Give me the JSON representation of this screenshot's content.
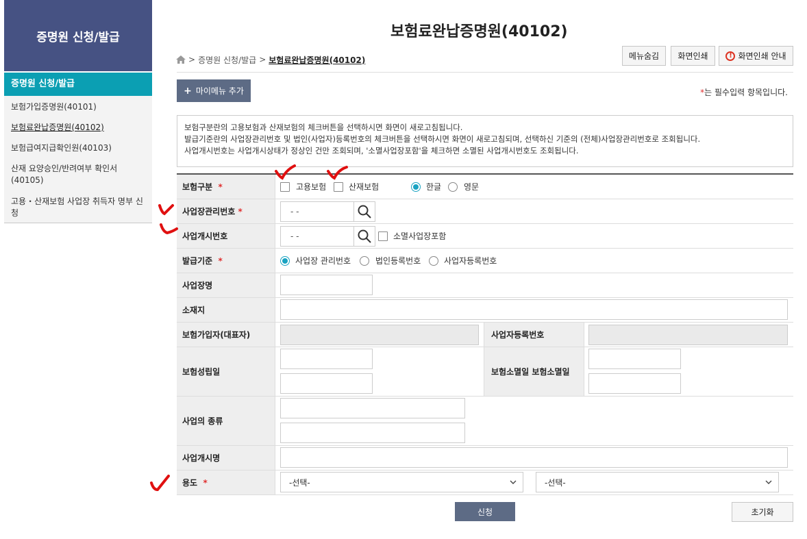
{
  "sidebar": {
    "title": "증명원 신청/발급",
    "active_section": "증명원 신청/발급",
    "items": [
      {
        "label": "보험가입증명원(40101)"
      },
      {
        "label": "보험료완납증명원(40102)"
      },
      {
        "label": "보험급여지급확인원(40103)"
      },
      {
        "label": "산재 요양승인/반려여부 확인서(40105)"
      },
      {
        "label": "고용・산재보험 사업장 취득자 명부 신청"
      }
    ]
  },
  "header": {
    "title": "보험료완납증명원(40102)",
    "breadcrumb": [
      "증명원 신청/발급",
      "보험료완납증명원(40102)"
    ],
    "buttons": {
      "hide_menu": "메뉴숨김",
      "print": "화면인쇄",
      "print_guide": "화면인쇄 안내"
    },
    "mymenu_add": "마이메뉴 추가",
    "required_note": "는 필수입력 항목입니다.",
    "required_mark": "*"
  },
  "info": {
    "lines": [
      "보험구분란의 고용보험과 산재보험의 체크버튼을 선택하시면 화면이 새로고침됩니다.",
      "발급기준란의 사업장관리번호 및 법인(사업자)등록번호의 체크버튼을 선택하시면 화면이 새로고침되며, 선택하신 기준의 (전체)사업장관리번호로 조회됩니다.",
      "사업개시번호는 사업개시상태가 정상인 건만 조회되며, '소멸사업장포함'을 체크하면 소멸된 사업개시번호도 조회됩니다."
    ]
  },
  "form": {
    "insurance_type": {
      "label": "보험구분",
      "options": [
        "고용보험",
        "산재보험"
      ],
      "lang_options": [
        "한글",
        "영문"
      ],
      "lang_selected": "한글"
    },
    "workplace_no": {
      "label": "사업장관리번호",
      "value": "-   -"
    },
    "start_no": {
      "label": "사업개시번호",
      "value": "-   -",
      "include_closed": "소멸사업장포함"
    },
    "issue_basis": {
      "label": "발급기준",
      "options": [
        "사업장 관리번호",
        "법인등록번호",
        "사업자등록번호"
      ],
      "selected": "사업장 관리번호"
    },
    "workplace_name": {
      "label": "사업장명"
    },
    "address": {
      "label": "소재지"
    },
    "insured": {
      "label": "보험가입자(대표자)"
    },
    "business_reg_no": {
      "label": "사업자등록번호"
    },
    "established": {
      "label": "보험성립일"
    },
    "extinguished": {
      "label": "보험소멸일 보험소멸일"
    },
    "business_type": {
      "label": "사업의 종류"
    },
    "start_name": {
      "label": "사업개시명"
    },
    "purpose": {
      "label": "용도",
      "select1": "-선택-",
      "select2": "-선택-"
    }
  },
  "actions": {
    "submit": "신청",
    "reset": "초기화"
  },
  "colors": {
    "sidebar_header": "#465283",
    "sidebar_active": "#0b9fb3",
    "button_primary": "#5d6b85",
    "annotation_red": "#e01010",
    "radio_on": "#1aa3c2"
  }
}
